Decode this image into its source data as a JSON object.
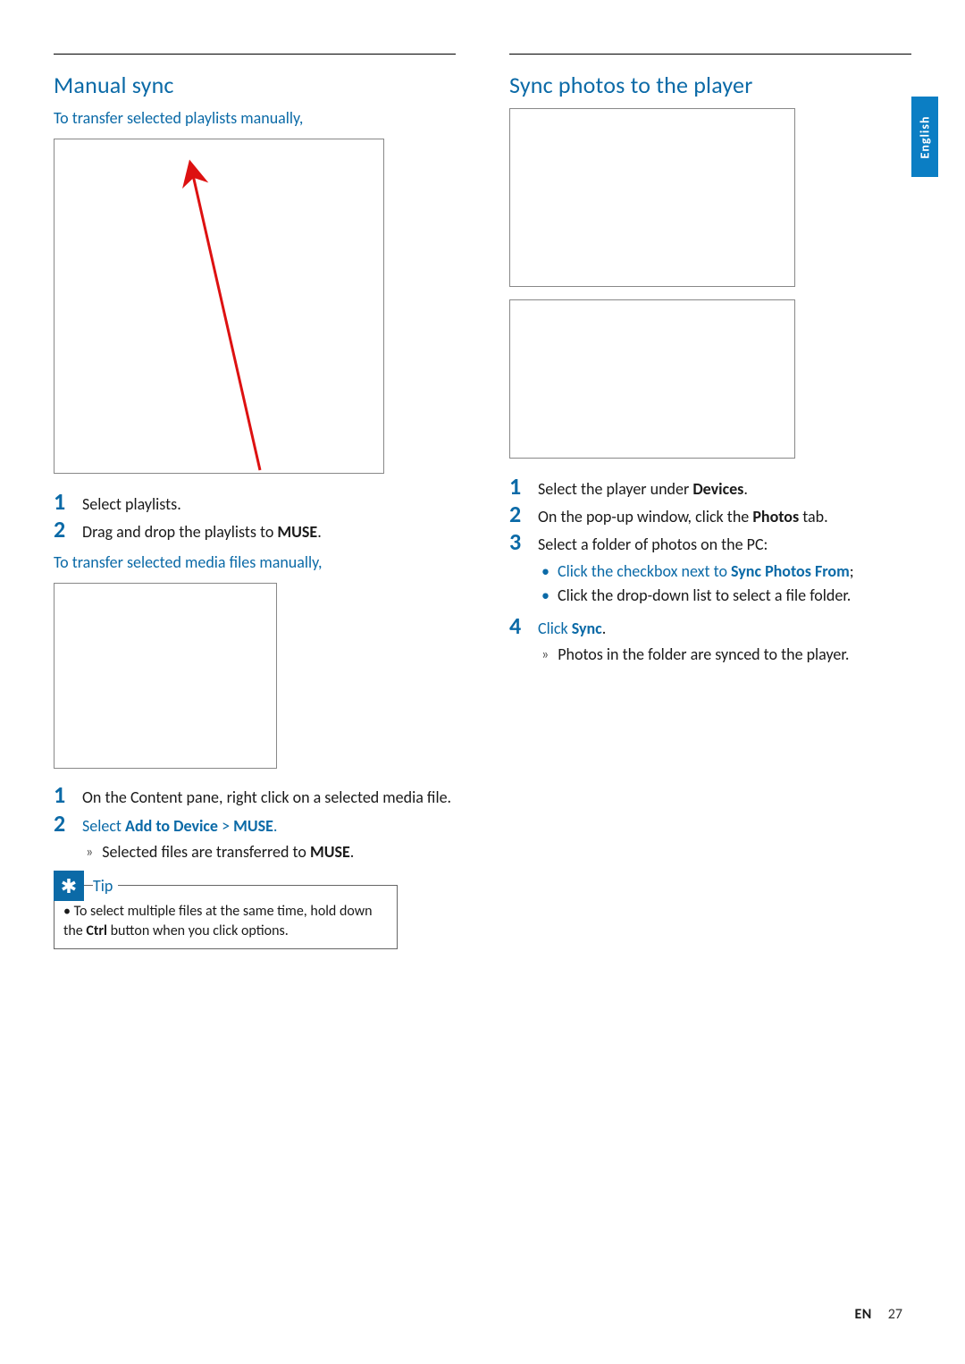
{
  "language_tab": "English",
  "footer": {
    "lang": "EN",
    "page": "27"
  },
  "left": {
    "heading": "Manual sync",
    "lead1": "To transfer selected playlists manually,",
    "steps_a": {
      "s1_num": "1",
      "s1_text": "Select playlists.",
      "s2_num": "2",
      "s2_pre": "Drag and drop the playlists to ",
      "s2_bold": "MUSE",
      "s2_post": "."
    },
    "lead2": "To transfer selected media files manually,",
    "steps_b": {
      "s1_num": "1",
      "s1_text": "On the Content pane, right click on a selected media file.",
      "s2_num": "2",
      "s2_pre": "Select ",
      "s2_b1": "Add to Device",
      "s2_mid": " > ",
      "s2_b2": "MUSE",
      "s2_post": ".",
      "s2_res_pre": "Selected files are transferred to ",
      "s2_res_bold": "MUSE",
      "s2_res_post": "."
    },
    "tip": {
      "label": "Tip",
      "text_pre": "To select multiple files at the same time, hold down the ",
      "text_bold": "Ctrl",
      "text_post": " button when you click options."
    }
  },
  "right": {
    "heading": "Sync photos to the player",
    "steps": {
      "s1_num": "1",
      "s1_pre": "Select the player under ",
      "s1_bold": "Devices",
      "s1_post": ".",
      "s2_num": "2",
      "s2_pre": "On the pop-up window, click the ",
      "s2_bold": "Photos",
      "s2_post": " tab.",
      "s3_num": "3",
      "s3_text": "Select a folder of photos on the PC:",
      "s3_b1_pre": "Click the checkbox next to ",
      "s3_b1_bold": "Sync Photos From",
      "s3_b1_post": ";",
      "s3_b2": "Click the drop-down list to select a file folder.",
      "s4_num": "4",
      "s4_pre": "Click ",
      "s4_bold": "Sync",
      "s4_post": ".",
      "s4_res": "Photos in the folder are synced to the player."
    }
  }
}
